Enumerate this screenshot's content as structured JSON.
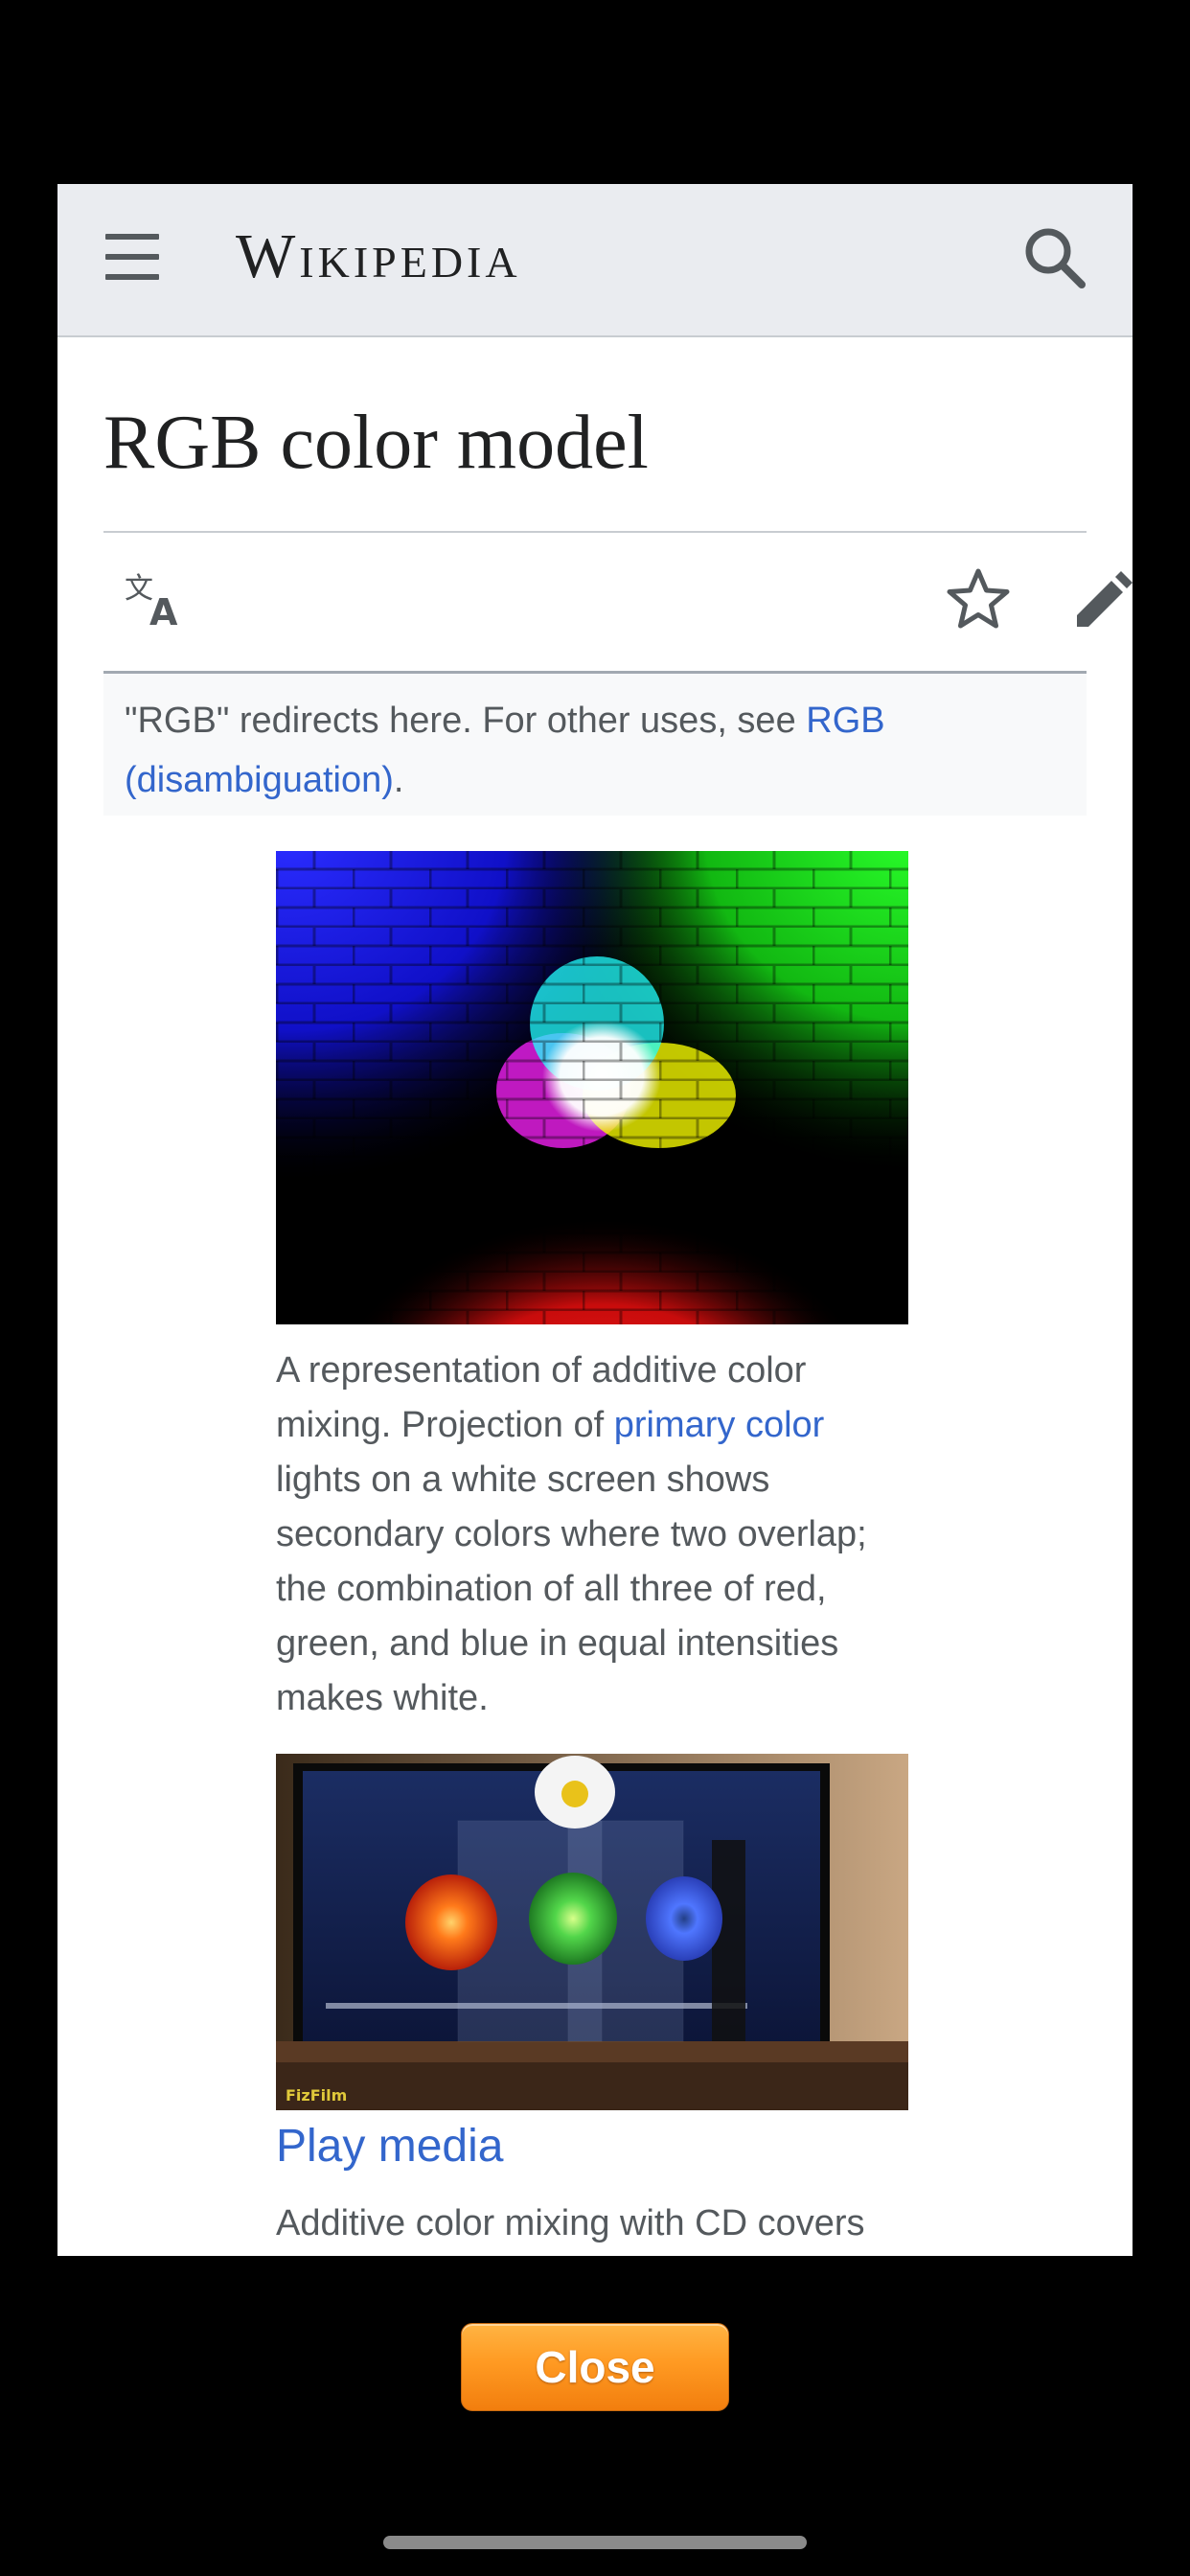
{
  "header": {
    "wordmark": "Wikipedia",
    "menu_icon": "hamburger-menu-icon",
    "search_icon": "search-icon"
  },
  "article": {
    "title": "RGB color model",
    "actions": {
      "language_icon": "translate-icon",
      "watch_icon": "star-icon",
      "edit_icon": "pencil-icon"
    },
    "hatnote": {
      "text": "\"RGB\" redirects here. For other uses, see ",
      "link_text": "RGB (disambiguation)",
      "suffix": "."
    },
    "figure1": {
      "caption_before": "A representation of additive color mixing. Projection of ",
      "caption_link": "primary color",
      "caption_after": " lights on a white screen shows secondary colors where two overlap; the combination of all three of red, green, and blue in equal intensities makes white."
    },
    "figure2": {
      "watermark": "FizFilm",
      "play_label": "Play media",
      "caption": "Additive color mixing with CD covers"
    }
  },
  "footer": {
    "close_label": "Close"
  },
  "colors": {
    "header_bg": "#eaecf0",
    "link": "#3366cc",
    "text": "#202122",
    "secondary_text": "#54595d",
    "close_button": "#ff9a22"
  }
}
